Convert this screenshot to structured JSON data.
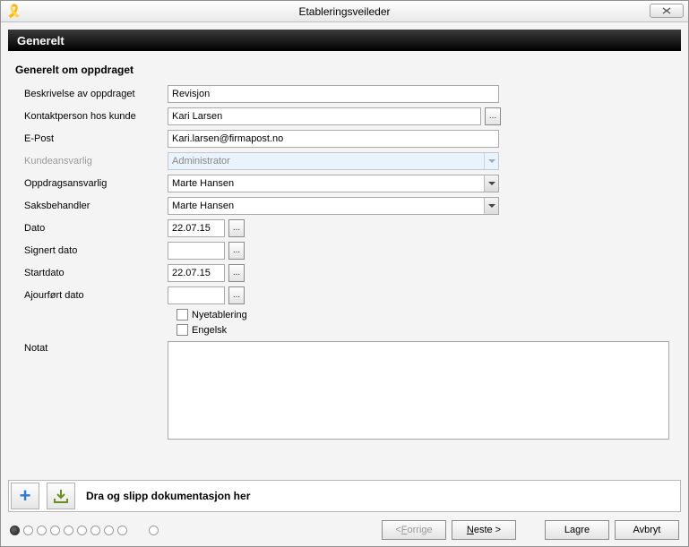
{
  "window": {
    "title": "Etableringsveileder"
  },
  "section": {
    "title": "Generelt"
  },
  "group": {
    "title": "Generelt om oppdraget"
  },
  "labels": {
    "beskrivelse": "Beskrivelse av oppdraget",
    "kontakt": "Kontaktperson hos kunde",
    "epost": "E-Post",
    "kundeansvarlig": "Kundeansvarlig",
    "oppdragsansvarlig": "Oppdragsansvarlig",
    "saksbehandler": "Saksbehandler",
    "dato": "Dato",
    "signert": "Signert dato",
    "startdato": "Startdato",
    "ajour": "Ajourført dato",
    "nyetablering": "Nyetablering",
    "engelsk": "Engelsk",
    "notat": "Notat"
  },
  "values": {
    "beskrivelse": "Revisjon",
    "kontakt": "Kari Larsen",
    "epost": "Kari.larsen@firmapost.no",
    "kundeansvarlig": "Administrator",
    "oppdragsansvarlig": "Marte Hansen",
    "saksbehandler": "Marte Hansen",
    "dato": "22.07.15",
    "signert": "",
    "startdato": "22.07.15",
    "ajour": "",
    "notat": ""
  },
  "dropzone": {
    "label": "Dra og slipp dokumentasjon her"
  },
  "buttons": {
    "ellipsis": "...",
    "forrige_prefix": "< ",
    "forrige_u": "F",
    "forrige_suffix": "orrige",
    "neste_u": "N",
    "neste_suffix": "este >",
    "lagre": "Lagre",
    "avbryt": "Avbryt"
  }
}
